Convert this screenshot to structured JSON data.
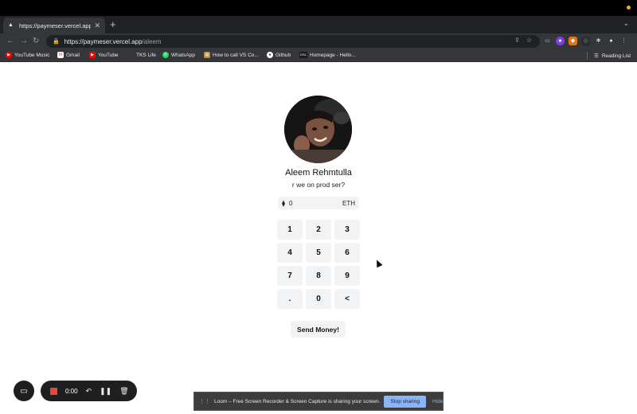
{
  "browser": {
    "tab": {
      "title": "https://paymeser.vercel.app/al",
      "close": "✕"
    },
    "new_tab": "+",
    "tab_menu": "⌄",
    "nav": {
      "back": "←",
      "forward": "→",
      "reload": "↻"
    },
    "url": {
      "host": "https://paymeser.vercel.app",
      "path": "/aleem"
    },
    "bookmarks": [
      {
        "label": "YouTube Music",
        "icon": "youtube-music-icon",
        "color": "#ff0000"
      },
      {
        "label": "Gmail",
        "icon": "gmail-icon",
        "color": "#ea4335"
      },
      {
        "label": "YouTube",
        "icon": "youtube-icon",
        "color": "#ff0000"
      },
      {
        "label": "TKS Life",
        "icon": "tks-icon",
        "color": "#35363a"
      },
      {
        "label": "WhatsApp",
        "icon": "whatsapp-icon",
        "color": "#25d366"
      },
      {
        "label": "How to call VS Co...",
        "icon": "page-icon",
        "color": "#c58b42"
      },
      {
        "label": "Github",
        "icon": "github-icon",
        "color": "#24292e"
      },
      {
        "label": "Homepage - Hello...",
        "icon": "dsl-icon",
        "color": "#1c1c1c"
      }
    ],
    "reading_list": "Reading List"
  },
  "profile": {
    "name": "Aleem Rehmtulla",
    "bio": "r we on prod ser?"
  },
  "amount": {
    "value": "0",
    "currency": "ETH",
    "icon": "ethereum-icon"
  },
  "keypad": [
    "1",
    "2",
    "3",
    "4",
    "5",
    "6",
    "7",
    "8",
    "9",
    ".",
    "0",
    "<"
  ],
  "send_button": "Send Money!",
  "loom": {
    "time": "0:00",
    "share_message": "Loom – Free Screen Recorder & Screen Capture is sharing your screen.",
    "stop_sharing": "Stop sharing",
    "hide": "Hide"
  }
}
